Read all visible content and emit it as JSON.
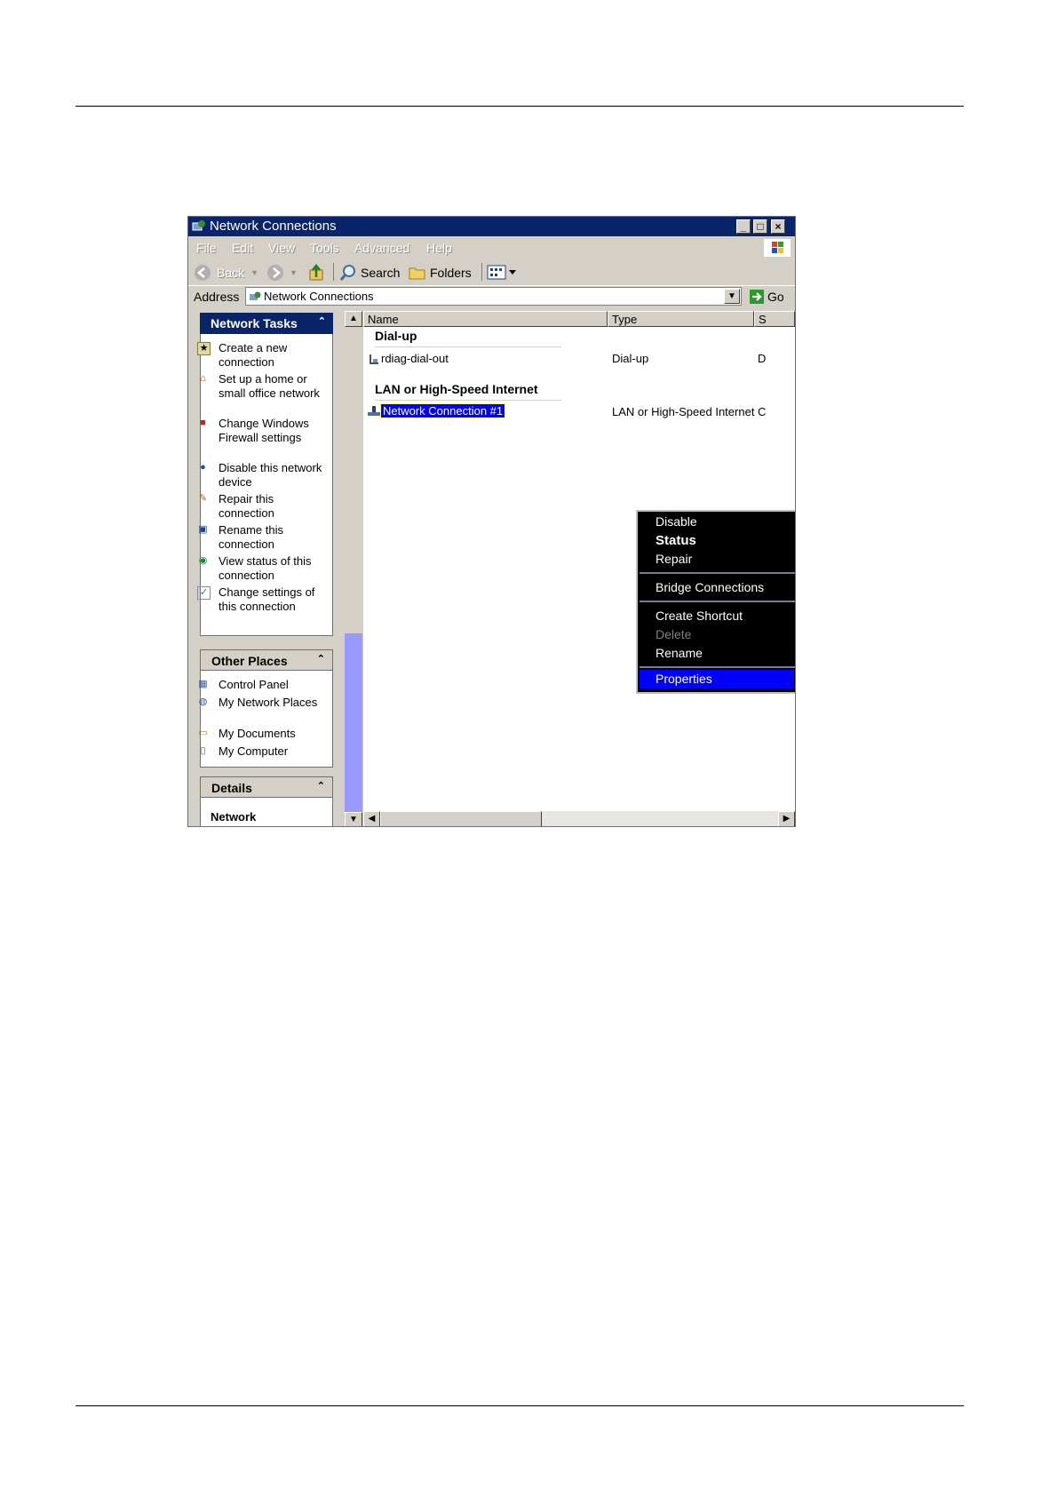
{
  "window": {
    "title": "Network Connections",
    "min_glyph": "_",
    "max_glyph": "□",
    "close_glyph": "×"
  },
  "menu": [
    "File",
    "Edit",
    "View",
    "Tools",
    "Advanced",
    "Help"
  ],
  "toolbar": {
    "back_label": "Back",
    "search_label": "Search",
    "folders_label": "Folders"
  },
  "address": {
    "label": "Address",
    "value": "Network Connections",
    "go_label": "Go"
  },
  "sidebar": {
    "network_tasks": {
      "title": "Network Tasks",
      "items": [
        {
          "icon": "create-connection-icon",
          "label": "Create a new connection"
        },
        {
          "icon": "home-network-icon",
          "label": "Set up a home or small office network"
        },
        {
          "icon": "firewall-icon",
          "label": "Change Windows Firewall settings"
        },
        {
          "icon": "disable-device-icon",
          "label": "Disable this network device"
        },
        {
          "icon": "repair-icon",
          "label": "Repair this connection"
        },
        {
          "icon": "rename-icon",
          "label": "Rename this connection"
        },
        {
          "icon": "status-icon",
          "label": "View status of this connection"
        },
        {
          "icon": "settings-icon",
          "label": "Change settings of this connection"
        }
      ]
    },
    "other_places": {
      "title": "Other Places",
      "items": [
        {
          "icon": "control-panel-icon",
          "label": "Control Panel"
        },
        {
          "icon": "network-places-icon",
          "label": "My Network Places"
        },
        {
          "icon": "documents-icon",
          "label": "My Documents"
        },
        {
          "icon": "computer-icon",
          "label": "My Computer"
        }
      ]
    },
    "details": {
      "title": "Details",
      "partial_text": "Network"
    },
    "collapse_glyph": "⌃"
  },
  "columns": [
    "Name",
    "Type",
    "S"
  ],
  "groups": [
    {
      "title": "Dial-up",
      "rows": [
        {
          "name": "rdiag-dial-out",
          "type": "Dial-up",
          "extra": "D"
        }
      ]
    },
    {
      "title": "LAN or High-Speed Internet",
      "rows": [
        {
          "name": "Network Connection #1",
          "type": "LAN or High-Speed Internet",
          "extra": "C"
        }
      ]
    }
  ],
  "context_menu": {
    "items": [
      "Disable",
      "Status",
      "Repair",
      "Bridge Connections",
      "Create Shortcut",
      "Delete",
      "Rename",
      "Properties"
    ],
    "default_item": "Status",
    "disabled_item": "Delete",
    "highlighted_item": "Properties"
  },
  "colors": {
    "titlebar": "#0a246a",
    "selection": "#0000ff",
    "scroll_thumb": "#9999ff"
  }
}
